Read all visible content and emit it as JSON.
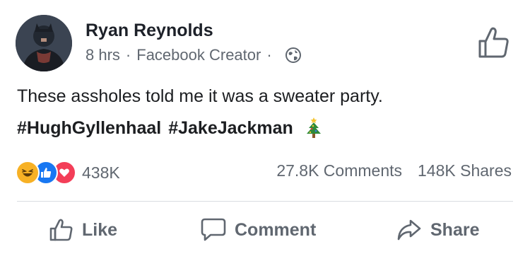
{
  "post": {
    "author": "Ryan Reynolds",
    "time": "8 hrs",
    "separator": "·",
    "source": "Facebook Creator",
    "separator2": "·",
    "text_line1": "These assholes told me it was a sweater party.",
    "hashtags": [
      "#HughGyllenhaal",
      "#JakeJackman"
    ],
    "emoji": "christmas-tree"
  },
  "engagement": {
    "reaction_icons": [
      "haha",
      "like",
      "love"
    ],
    "reactions_count": "438K",
    "comments": "27.8K Comments",
    "shares": "148K Shares"
  },
  "actions": {
    "like": "Like",
    "comment": "Comment",
    "share": "Share"
  },
  "colors": {
    "text": "#1c1e21",
    "muted": "#606770",
    "like_blue": "#1877f2",
    "love_red": "#f33e58",
    "haha_yellow": "#f7b125"
  }
}
